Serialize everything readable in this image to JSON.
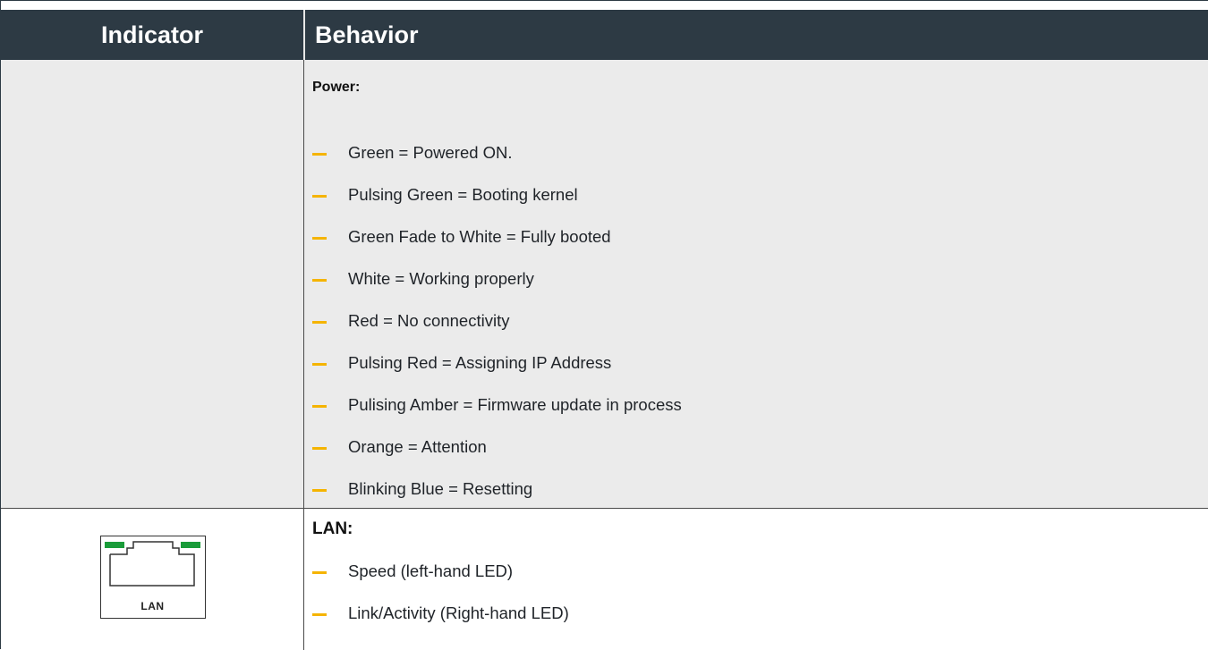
{
  "header": {
    "indicator_label": "Indicator",
    "behavior_label": "Behavior",
    "background_color": "#2d3a44"
  },
  "power": {
    "title": "Power:",
    "items": [
      "Green = Powered ON.",
      "Pulsing Green = Booting kernel",
      "Green Fade to White = Fully booted",
      "White = Working properly",
      "Red = No connectivity",
      "Pulsing Red = Assigning IP Address",
      "Pulising Amber = Firmware update in process",
      "Orange = Attention",
      "Blinking Blue = Resetting"
    ]
  },
  "lan": {
    "title": "LAN:",
    "icon": "ethernet-port-icon",
    "icon_label": "LAN",
    "led_color": "#1a9c3a",
    "items": [
      "Speed (left-hand LED)",
      "Link/Activity (Right-hand LED)"
    ]
  },
  "colors": {
    "bullet_dash": "#f5b400",
    "row_shaded": "#ebebeb"
  }
}
